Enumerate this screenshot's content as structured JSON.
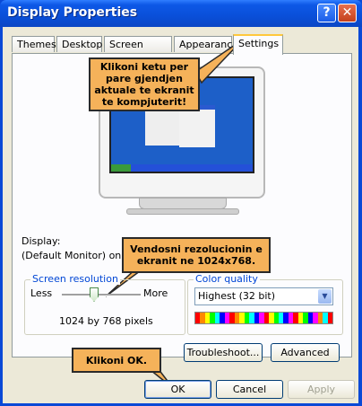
{
  "window": {
    "title": "Display Properties"
  },
  "tabs": [
    {
      "label": "Themes"
    },
    {
      "label": "Desktop"
    },
    {
      "label": "Screen Saver"
    },
    {
      "label": "Appearance"
    },
    {
      "label": "Settings"
    }
  ],
  "active_tab": "Settings",
  "callouts": {
    "top": "Klikoni ketu per pare gjendjen aktuale te ekranit te kompjuterit!",
    "resolution": "Vendosni rezolucionin e ekranit ne 1024x768.",
    "ok": "Klikoni OK."
  },
  "display": {
    "label": "Display:",
    "monitor": "(Default Monitor) on"
  },
  "screen_resolution": {
    "title": "Screen resolution",
    "less": "Less",
    "more": "More",
    "value": "1024 by 768 pixels"
  },
  "color_quality": {
    "title": "Color quality",
    "selected": "Highest (32 bit)"
  },
  "buttons": {
    "troubleshoot": "Troubleshoot...",
    "advanced": "Advanced",
    "ok": "OK",
    "cancel": "Cancel",
    "apply": "Apply"
  },
  "colors": {
    "titlebar": "#0a49d6",
    "callout": "#f5b25a",
    "active_tab_highlight": "#ffc83c"
  }
}
